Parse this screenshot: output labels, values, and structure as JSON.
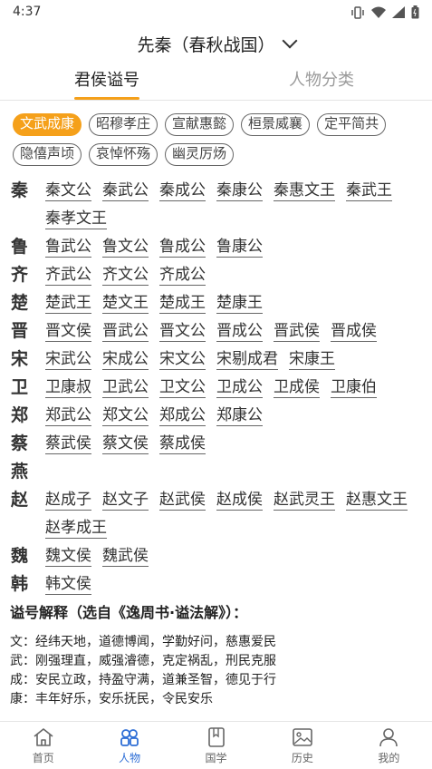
{
  "status": {
    "time": "4:37"
  },
  "header": {
    "title": "先秦（春秋战国）"
  },
  "tabs": [
    {
      "label": "君侯谥号",
      "active": true
    },
    {
      "label": "人物分类",
      "active": false
    }
  ],
  "chips": {
    "row1": [
      "文武成康",
      "昭穆孝庄",
      "宣献惠懿",
      "桓景威襄",
      "定平简共"
    ],
    "row2": [
      "隐僖声顷",
      "哀悼怀殇",
      "幽灵厉炀"
    ]
  },
  "states": [
    {
      "name": "秦",
      "rulers": [
        "秦文公",
        "秦武公",
        "秦成公",
        "秦康公",
        "秦惠文王",
        "秦武王",
        "秦孝文王"
      ]
    },
    {
      "name": "鲁",
      "rulers": [
        "鲁武公",
        "鲁文公",
        "鲁成公",
        "鲁康公"
      ]
    },
    {
      "name": "齐",
      "rulers": [
        "齐武公",
        "齐文公",
        "齐成公"
      ]
    },
    {
      "name": "楚",
      "rulers": [
        "楚武王",
        "楚文王",
        "楚成王",
        "楚康王"
      ]
    },
    {
      "name": "晋",
      "rulers": [
        "晋文侯",
        "晋武公",
        "晋文公",
        "晋成公",
        "晋武侯",
        "晋成侯"
      ]
    },
    {
      "name": "宋",
      "rulers": [
        "宋武公",
        "宋成公",
        "宋文公",
        "宋剔成君",
        "宋康王"
      ]
    },
    {
      "name": "卫",
      "rulers": [
        "卫康叔",
        "卫武公",
        "卫文公",
        "卫成公",
        "卫成侯",
        "卫康伯"
      ]
    },
    {
      "name": "郑",
      "rulers": [
        "郑武公",
        "郑文公",
        "郑成公",
        "郑康公"
      ]
    },
    {
      "name": "蔡",
      "rulers": [
        "蔡武侯",
        "蔡文侯",
        "蔡成侯"
      ]
    },
    {
      "name": "燕",
      "rulers": []
    },
    {
      "name": "赵",
      "rulers": [
        "赵成子",
        "赵文子",
        "赵武侯",
        "赵成侯",
        "赵武灵王",
        "赵惠文王",
        "赵孝成王"
      ]
    },
    {
      "name": "魏",
      "rulers": [
        "魏文侯",
        "魏武侯"
      ]
    },
    {
      "name": "韩",
      "rulers": [
        "韩文侯"
      ]
    }
  ],
  "explanation": {
    "title": "谥号解释（选自《逸周书·谥法解》）：",
    "lines": [
      "文：经纬天地，道德博闻，学勤好问，慈惠爱民",
      "武：刚强理直，威强濬德，克定祸乱，刑民克服",
      "成：安民立政，持盈守满，道兼圣智，德见于行",
      "康：丰年好乐，安乐抚民，令民安乐"
    ]
  },
  "bottom_nav": [
    {
      "label": "首页",
      "icon": "home-icon",
      "active": false
    },
    {
      "label": "人物",
      "icon": "people-icon",
      "active": true
    },
    {
      "label": "国学",
      "icon": "book-icon",
      "active": false
    },
    {
      "label": "历史",
      "icon": "image-icon",
      "active": false
    },
    {
      "label": "我的",
      "icon": "person-icon",
      "active": false
    }
  ],
  "colors": {
    "accent": "#f5a01a",
    "nav_active": "#2f6fd6"
  }
}
